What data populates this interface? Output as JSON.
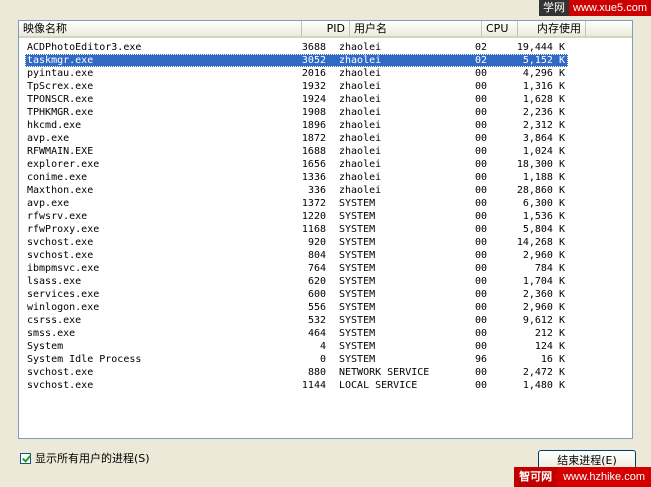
{
  "columns": {
    "name": "映像名称",
    "pid": "PID",
    "user": "用户名",
    "cpu": "CPU",
    "mem": "内存使用"
  },
  "processes": [
    {
      "name": "ACDPhotoEditor3.exe",
      "pid": "3688",
      "user": "zhaolei",
      "cpu": "02",
      "mem": "19,444 K"
    },
    {
      "name": "taskmgr.exe",
      "pid": "3052",
      "user": "zhaolei",
      "cpu": "02",
      "mem": "5,152 K",
      "selected": true
    },
    {
      "name": "pyintau.exe",
      "pid": "2016",
      "user": "zhaolei",
      "cpu": "00",
      "mem": "4,296 K"
    },
    {
      "name": "TpScrex.exe",
      "pid": "1932",
      "user": "zhaolei",
      "cpu": "00",
      "mem": "1,316 K"
    },
    {
      "name": "TPONSCR.exe",
      "pid": "1924",
      "user": "zhaolei",
      "cpu": "00",
      "mem": "1,628 K"
    },
    {
      "name": "TPHKMGR.exe",
      "pid": "1908",
      "user": "zhaolei",
      "cpu": "00",
      "mem": "2,236 K"
    },
    {
      "name": "hkcmd.exe",
      "pid": "1896",
      "user": "zhaolei",
      "cpu": "00",
      "mem": "2,312 K"
    },
    {
      "name": "avp.exe",
      "pid": "1872",
      "user": "zhaolei",
      "cpu": "00",
      "mem": "3,864 K"
    },
    {
      "name": "RFWMAIN.EXE",
      "pid": "1688",
      "user": "zhaolei",
      "cpu": "00",
      "mem": "1,024 K"
    },
    {
      "name": "explorer.exe",
      "pid": "1656",
      "user": "zhaolei",
      "cpu": "00",
      "mem": "18,300 K"
    },
    {
      "name": "conime.exe",
      "pid": "1336",
      "user": "zhaolei",
      "cpu": "00",
      "mem": "1,188 K"
    },
    {
      "name": "Maxthon.exe",
      "pid": "336",
      "user": "zhaolei",
      "cpu": "00",
      "mem": "28,860 K"
    },
    {
      "name": "avp.exe",
      "pid": "1372",
      "user": "SYSTEM",
      "cpu": "00",
      "mem": "6,300 K"
    },
    {
      "name": "rfwsrv.exe",
      "pid": "1220",
      "user": "SYSTEM",
      "cpu": "00",
      "mem": "1,536 K"
    },
    {
      "name": "rfwProxy.exe",
      "pid": "1168",
      "user": "SYSTEM",
      "cpu": "00",
      "mem": "5,804 K"
    },
    {
      "name": "svchost.exe",
      "pid": "920",
      "user": "SYSTEM",
      "cpu": "00",
      "mem": "14,268 K"
    },
    {
      "name": "svchost.exe",
      "pid": "804",
      "user": "SYSTEM",
      "cpu": "00",
      "mem": "2,960 K"
    },
    {
      "name": "ibmpmsvc.exe",
      "pid": "764",
      "user": "SYSTEM",
      "cpu": "00",
      "mem": "784 K"
    },
    {
      "name": "lsass.exe",
      "pid": "620",
      "user": "SYSTEM",
      "cpu": "00",
      "mem": "1,704 K"
    },
    {
      "name": "services.exe",
      "pid": "600",
      "user": "SYSTEM",
      "cpu": "00",
      "mem": "2,360 K"
    },
    {
      "name": "winlogon.exe",
      "pid": "556",
      "user": "SYSTEM",
      "cpu": "00",
      "mem": "2,960 K"
    },
    {
      "name": "csrss.exe",
      "pid": "532",
      "user": "SYSTEM",
      "cpu": "00",
      "mem": "9,612 K"
    },
    {
      "name": "smss.exe",
      "pid": "464",
      "user": "SYSTEM",
      "cpu": "00",
      "mem": "212 K"
    },
    {
      "name": "System",
      "pid": "4",
      "user": "SYSTEM",
      "cpu": "00",
      "mem": "124 K"
    },
    {
      "name": "System Idle Process",
      "pid": "0",
      "user": "SYSTEM",
      "cpu": "96",
      "mem": "16 K"
    },
    {
      "name": "svchost.exe",
      "pid": "880",
      "user": "NETWORK SERVICE",
      "cpu": "00",
      "mem": "2,472 K"
    },
    {
      "name": "svchost.exe",
      "pid": "1144",
      "user": "LOCAL SERVICE",
      "cpu": "00",
      "mem": "1,480 K"
    }
  ],
  "show_all_users": {
    "label": "显示所有用户的进程(S)",
    "checked": true
  },
  "end_process_button": "结束进程(E)",
  "watermark_top": {
    "a": "学网",
    "b": "www.xue5.com"
  },
  "watermark_bottom": {
    "a": "智可网",
    "b": "www.hzhike.com"
  },
  "colors": {
    "selection": "#316ac5",
    "window_bg": "#ece9d8"
  }
}
